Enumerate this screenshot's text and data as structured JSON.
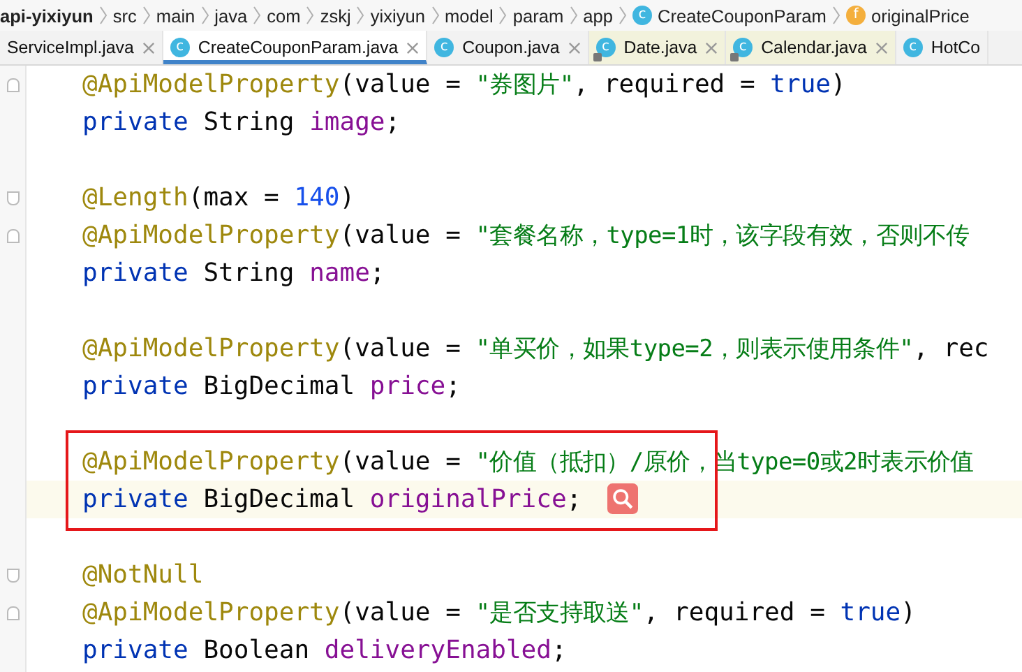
{
  "breadcrumbs": [
    {
      "label": "api-yixiyun",
      "kind": "project"
    },
    {
      "label": "src",
      "kind": "folder"
    },
    {
      "label": "main",
      "kind": "folder"
    },
    {
      "label": "java",
      "kind": "folder"
    },
    {
      "label": "com",
      "kind": "folder"
    },
    {
      "label": "zskj",
      "kind": "folder"
    },
    {
      "label": "yixiyun",
      "kind": "folder"
    },
    {
      "label": "model",
      "kind": "folder"
    },
    {
      "label": "param",
      "kind": "folder"
    },
    {
      "label": "app",
      "kind": "folder"
    },
    {
      "label": "CreateCouponParam",
      "kind": "class",
      "badge": "c"
    },
    {
      "label": "originalPrice",
      "kind": "field",
      "badge": "f"
    }
  ],
  "tabs": [
    {
      "label": "ServiceImpl.java",
      "selected": false,
      "locked": false,
      "closable": true
    },
    {
      "label": "CreateCouponParam.java",
      "badge": "c",
      "selected": true,
      "locked": false,
      "closable": true
    },
    {
      "label": "Coupon.java",
      "badge": "c",
      "selected": false,
      "locked": false,
      "closable": true
    },
    {
      "label": "Date.java",
      "badge": "c",
      "selected": false,
      "locked": true,
      "closable": true
    },
    {
      "label": "Calendar.java",
      "badge": "c",
      "selected": false,
      "locked": true,
      "closable": true
    },
    {
      "label": "HotCo",
      "badge": "c",
      "selected": false,
      "locked": false,
      "closable": false
    }
  ],
  "editor": {
    "lines": [
      {
        "fold_close": true,
        "tokens": [
          {
            "kind": "annotation",
            "text": "@ApiModelProperty"
          },
          {
            "kind": "plain",
            "text": "(value = "
          },
          {
            "kind": "string",
            "text": "\"券图片\""
          },
          {
            "kind": "plain",
            "text": ", required = "
          },
          {
            "kind": "keyword",
            "text": "true"
          },
          {
            "kind": "plain",
            "text": ")"
          }
        ]
      },
      {
        "tokens": [
          {
            "kind": "keyword",
            "text": "private"
          },
          {
            "kind": "plain",
            "text": " String "
          },
          {
            "kind": "field",
            "text": "image"
          },
          {
            "kind": "plain",
            "text": ";"
          }
        ]
      },
      {
        "gap_before": true,
        "fold_open": true,
        "tokens": [
          {
            "kind": "annotation",
            "text": "@Length"
          },
          {
            "kind": "plain",
            "text": "(max = "
          },
          {
            "kind": "number",
            "text": "140"
          },
          {
            "kind": "plain",
            "text": ")"
          }
        ]
      },
      {
        "fold_close": true,
        "tokens": [
          {
            "kind": "annotation",
            "text": "@ApiModelProperty"
          },
          {
            "kind": "plain",
            "text": "(value = "
          },
          {
            "kind": "string",
            "text": "\"套餐名称，type=1时，该字段有效，否则不传"
          }
        ]
      },
      {
        "tokens": [
          {
            "kind": "keyword",
            "text": "private"
          },
          {
            "kind": "plain",
            "text": " String "
          },
          {
            "kind": "field",
            "text": "name"
          },
          {
            "kind": "plain",
            "text": ";"
          }
        ]
      },
      {
        "gap_before": true,
        "tokens": [
          {
            "kind": "annotation",
            "text": "@ApiModelProperty"
          },
          {
            "kind": "plain",
            "text": "(value = "
          },
          {
            "kind": "string",
            "text": "\"单买价，如果type=2，则表示使用条件\""
          },
          {
            "kind": "plain",
            "text": ", rec"
          }
        ]
      },
      {
        "tokens": [
          {
            "kind": "keyword",
            "text": "private"
          },
          {
            "kind": "plain",
            "text": " BigDecimal "
          },
          {
            "kind": "field",
            "text": "price"
          },
          {
            "kind": "plain",
            "text": ";"
          }
        ]
      },
      {
        "gap_before": true,
        "boxed": true,
        "tokens": [
          {
            "kind": "annotation",
            "text": "@ApiModelProperty"
          },
          {
            "kind": "plain",
            "text": "(value = "
          },
          {
            "kind": "string",
            "text": "\"价值（抵扣）/原价，当type=0或2时表示价值"
          }
        ]
      },
      {
        "boxed": true,
        "current": true,
        "tokens": [
          {
            "kind": "keyword",
            "text": "private"
          },
          {
            "kind": "plain",
            "text": " BigDecimal "
          },
          {
            "kind": "field",
            "text": "originalPrice"
          },
          {
            "kind": "plain",
            "text": ";"
          }
        ]
      },
      {
        "gap_before": true,
        "fold_open": true,
        "tokens": [
          {
            "kind": "annotation",
            "text": "@NotNull"
          }
        ]
      },
      {
        "fold_close": true,
        "tokens": [
          {
            "kind": "annotation",
            "text": "@ApiModelProperty"
          },
          {
            "kind": "plain",
            "text": "(value = "
          },
          {
            "kind": "string",
            "text": "\"是否支持取送\""
          },
          {
            "kind": "plain",
            "text": ", required = "
          },
          {
            "kind": "keyword",
            "text": "true"
          },
          {
            "kind": "plain",
            "text": ")"
          }
        ]
      },
      {
        "tokens": [
          {
            "kind": "keyword",
            "text": "private"
          },
          {
            "kind": "plain",
            "text": " Boolean "
          },
          {
            "kind": "field",
            "text": "deliveryEnabled"
          },
          {
            "kind": "plain",
            "text": ";"
          }
        ]
      }
    ]
  }
}
